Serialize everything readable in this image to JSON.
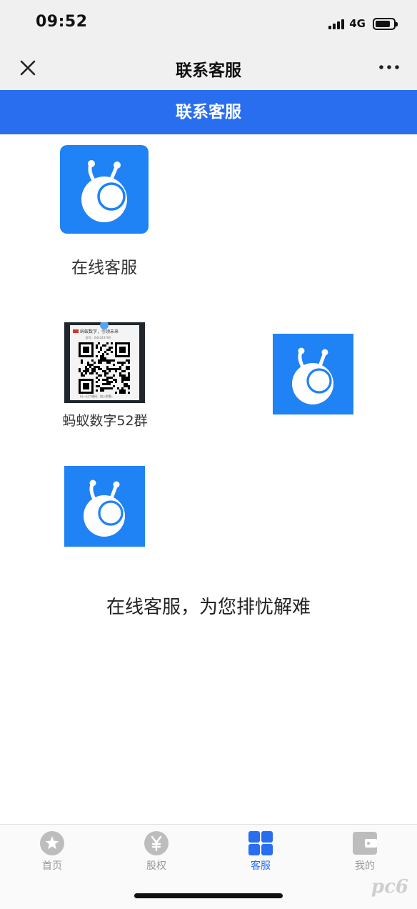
{
  "status_bar": {
    "time": "09:52",
    "network": "4G",
    "battery_level": 0.85
  },
  "nav": {
    "title": "联系客服",
    "close_icon": "close-icon",
    "more_icon": "more-icon"
  },
  "banner": {
    "title": "联系客服"
  },
  "services": {
    "online_label": "在线客服",
    "group_label": "蚂蚁数字52群",
    "qr_header": "蚂蚁数字，引领未来",
    "qr_id": "群号：644243769",
    "qr_footer": "扫一扫二维码，加入群聊。",
    "tagline": "在线客服，为您排忧解难"
  },
  "tabs": [
    {
      "label": "首页",
      "icon": "star-icon",
      "active": false
    },
    {
      "label": "股权",
      "icon": "yen-icon",
      "active": false
    },
    {
      "label": "客服",
      "icon": "grid-icon",
      "active": true
    },
    {
      "label": "我的",
      "icon": "wallet-icon",
      "active": false
    }
  ],
  "watermark": "pc6",
  "colors": {
    "accent": "#2a6ef0",
    "icon_blue": "#1f82f5",
    "bar_bg": "#f0f0f0"
  }
}
